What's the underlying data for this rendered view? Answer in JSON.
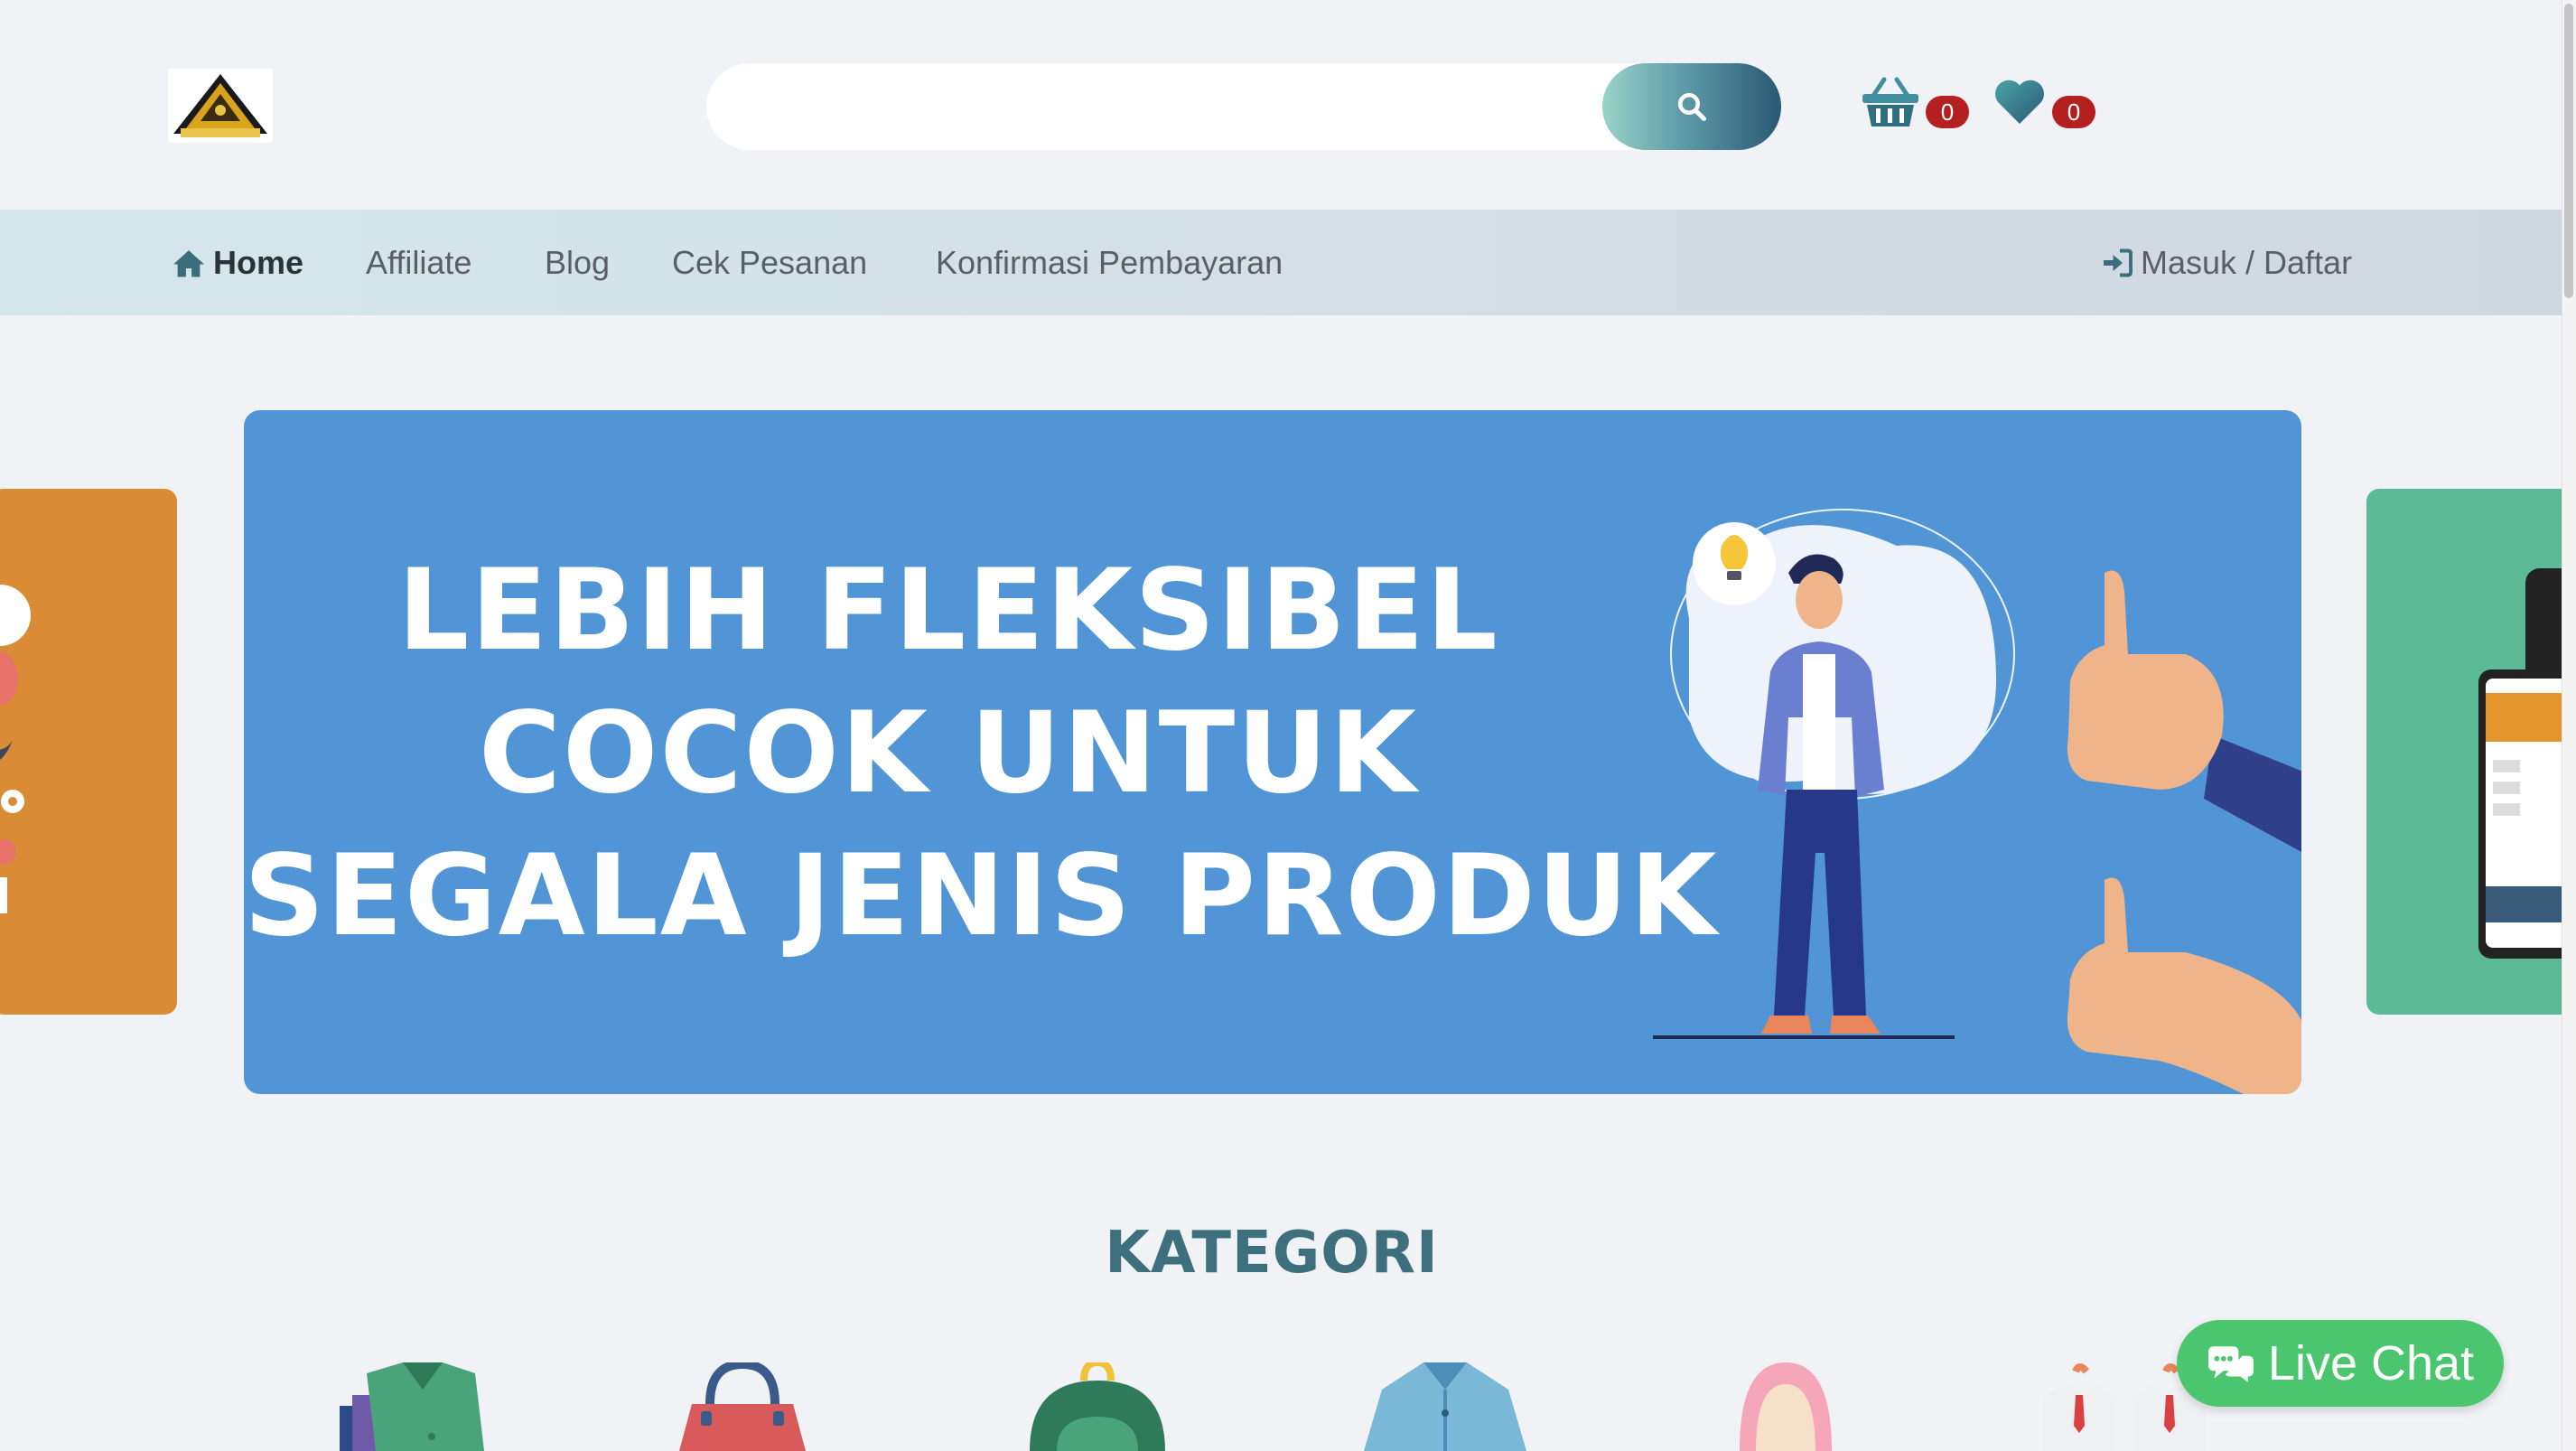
{
  "header": {
    "search": {
      "placeholder": "",
      "value": ""
    },
    "cart_count": "0",
    "wishlist_count": "0"
  },
  "nav": {
    "items": [
      {
        "label": "Home",
        "icon": "home-icon",
        "active": true
      },
      {
        "label": "Affiliate"
      },
      {
        "label": "Blog"
      },
      {
        "label": "Cek Pesanan"
      },
      {
        "label": "Konfirmasi Pembayaran"
      }
    ],
    "login_label": "Masuk / Daftar"
  },
  "banner": {
    "lines": [
      "LEBIH FLEKSIBEL",
      "COCOK UNTUK",
      "SEGALA JENIS PRODUK"
    ],
    "bg_color": "#5195d6"
  },
  "kategori": {
    "title": "KATEGORI",
    "icons": [
      "shirt-stack-icon",
      "handbag-icon",
      "backpack-icon",
      "jacket-icon",
      "hijab-icon",
      "uniform-icon"
    ]
  },
  "live_chat": {
    "label": "Live Chat",
    "color": "#4cc66e"
  },
  "colors": {
    "accent": "#2a5874",
    "badge": "#b3201f",
    "title": "#3d6f7c"
  }
}
